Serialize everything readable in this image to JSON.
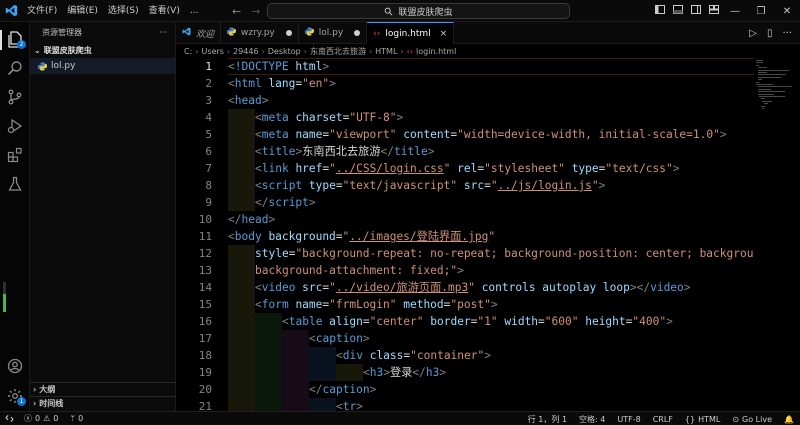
{
  "title_bar": {
    "menus": [
      "文件(F)",
      "编辑(E)",
      "选择(S)",
      "查看(V)",
      "..."
    ],
    "back_icon": "arrow-left-icon",
    "forward_icon": "arrow-right-icon",
    "search_text": "联盟皮肤爬虫"
  },
  "activity_bar": {
    "explorer_badge": "2",
    "accounts_badge": "",
    "manage_badge": "1",
    "icons": [
      "files-icon",
      "search-icon",
      "source-control-icon",
      "run-debug-icon",
      "extensions-icon",
      "testing-icon",
      "account-icon",
      "manage-gear-icon"
    ],
    "indicator_level": 0.6
  },
  "sidebar": {
    "header": "资源管理器",
    "more": "···",
    "folder": "联盟皮肤爬虫",
    "files": [
      {
        "name": "lol.py"
      }
    ],
    "sections": [
      "大纲",
      "时间线"
    ]
  },
  "tabs": [
    {
      "label": "欢迎",
      "icon": "vscode-icon",
      "italic": true
    },
    {
      "label": "wzry.py",
      "icon": "python-icon",
      "dirty": true
    },
    {
      "label": "lol.py",
      "icon": "python-icon",
      "dirty": true
    },
    {
      "label": "login.html",
      "icon": "html-icon",
      "active": true,
      "close": "×"
    }
  ],
  "tab_actions": {
    "run": "▷",
    "split": "▯",
    "more": "···"
  },
  "breadcrumb": [
    "C:",
    "Users",
    "29446",
    "Desktop",
    "东南西北去旅游",
    "HTML",
    "login.html"
  ],
  "editor": {
    "current_line": 1,
    "lines": [
      {
        "n": "1",
        "indent": 0,
        "tokens": [
          [
            "punc",
            "<"
          ],
          [
            "tag",
            "!DOCTYPE "
          ],
          [
            "attr",
            "html"
          ],
          [
            "punc",
            ">"
          ]
        ]
      },
      {
        "n": "2",
        "indent": 0,
        "tokens": [
          [
            "punc",
            "<"
          ],
          [
            "tag",
            "html "
          ],
          [
            "attr",
            "lang"
          ],
          [
            "txt",
            "="
          ],
          [
            "str",
            "\"en\""
          ],
          [
            "punc",
            ">"
          ]
        ]
      },
      {
        "n": "3",
        "indent": 0,
        "tokens": [
          [
            "punc",
            "<"
          ],
          [
            "tag",
            "head"
          ],
          [
            "punc",
            ">"
          ]
        ]
      },
      {
        "n": "4",
        "indent": 1,
        "tokens": [
          [
            "punc",
            "<"
          ],
          [
            "tag",
            "meta "
          ],
          [
            "attr",
            "charset"
          ],
          [
            "txt",
            "="
          ],
          [
            "str",
            "\"UTF-8\""
          ],
          [
            "punc",
            ">"
          ]
        ]
      },
      {
        "n": "5",
        "indent": 1,
        "tokens": [
          [
            "punc",
            "<"
          ],
          [
            "tag",
            "meta "
          ],
          [
            "attr",
            "name"
          ],
          [
            "txt",
            "="
          ],
          [
            "str",
            "\"viewport\" "
          ],
          [
            "attr",
            "content"
          ],
          [
            "txt",
            "="
          ],
          [
            "str",
            "\"width=device-width, initial-scale=1.0\""
          ],
          [
            "punc",
            ">"
          ]
        ]
      },
      {
        "n": "6",
        "indent": 1,
        "tokens": [
          [
            "punc",
            "<"
          ],
          [
            "tag",
            "title"
          ],
          [
            "punc",
            ">"
          ],
          [
            "txt",
            "东南西北去旅游"
          ],
          [
            "punc",
            "</"
          ],
          [
            "tag",
            "title"
          ],
          [
            "punc",
            ">"
          ]
        ]
      },
      {
        "n": "7",
        "indent": 1,
        "tokens": [
          [
            "punc",
            "<"
          ],
          [
            "tag",
            "link "
          ],
          [
            "attr",
            "href"
          ],
          [
            "txt",
            "="
          ],
          [
            "str",
            "\""
          ],
          [
            "strlink",
            "../CSS/login.css"
          ],
          [
            "str",
            "\" "
          ],
          [
            "attr",
            "rel"
          ],
          [
            "txt",
            "="
          ],
          [
            "str",
            "\"stylesheet\" "
          ],
          [
            "attr",
            "type"
          ],
          [
            "txt",
            "="
          ],
          [
            "str",
            "\"text/css\""
          ],
          [
            "punc",
            ">"
          ]
        ]
      },
      {
        "n": "8",
        "indent": 1,
        "tokens": [
          [
            "punc",
            "<"
          ],
          [
            "tag",
            "script "
          ],
          [
            "attr",
            "type"
          ],
          [
            "txt",
            "="
          ],
          [
            "str",
            "\"text/javascript\" "
          ],
          [
            "attr",
            "src"
          ],
          [
            "txt",
            "="
          ],
          [
            "str",
            "\""
          ],
          [
            "strlink",
            "../js/login.js"
          ],
          [
            "str",
            "\""
          ],
          [
            "punc",
            ">"
          ]
        ]
      },
      {
        "n": "9",
        "indent": 1,
        "tokens": [
          [
            "punc",
            "</"
          ],
          [
            "tag",
            "script"
          ],
          [
            "punc",
            ">"
          ]
        ]
      },
      {
        "n": "10",
        "indent": 0,
        "tokens": [
          [
            "punc",
            "</"
          ],
          [
            "tag",
            "head"
          ],
          [
            "punc",
            ">"
          ]
        ]
      },
      {
        "n": "11",
        "indent": 0,
        "tokens": [
          [
            "punc",
            "<"
          ],
          [
            "tag",
            "body "
          ],
          [
            "attr",
            "background"
          ],
          [
            "txt",
            "="
          ],
          [
            "str",
            "\""
          ],
          [
            "strlink",
            "../images/登陆界面.jpg"
          ],
          [
            "str",
            "\""
          ]
        ]
      },
      {
        "n": "12",
        "indent": 1,
        "tokens": [
          [
            "attr",
            "style"
          ],
          [
            "txt",
            "="
          ],
          [
            "str",
            "\"background-repeat: no-repeat; background-position: center; background-size: cover;"
          ]
        ]
      },
      {
        "n": "13",
        "indent": 1,
        "tokens": [
          [
            "str",
            "background-attachment: fixed;\""
          ],
          [
            "punc",
            ">"
          ]
        ]
      },
      {
        "n": "14",
        "indent": 1,
        "tokens": [
          [
            "punc",
            "<"
          ],
          [
            "tag",
            "video "
          ],
          [
            "attr",
            "src"
          ],
          [
            "txt",
            "="
          ],
          [
            "str",
            "\""
          ],
          [
            "strlink",
            "../video/旅游页面.mp3"
          ],
          [
            "str",
            "\" "
          ],
          [
            "attr",
            "controls autoplay loop"
          ],
          [
            "punc",
            "></"
          ],
          [
            "tag",
            "video"
          ],
          [
            "punc",
            ">"
          ]
        ]
      },
      {
        "n": "15",
        "indent": 1,
        "tokens": [
          [
            "punc",
            "<"
          ],
          [
            "tag",
            "form "
          ],
          [
            "attr",
            "name"
          ],
          [
            "txt",
            "="
          ],
          [
            "str",
            "\"frmLogin\" "
          ],
          [
            "attr",
            "method"
          ],
          [
            "txt",
            "="
          ],
          [
            "str",
            "\"post\""
          ],
          [
            "punc",
            ">"
          ]
        ]
      },
      {
        "n": "16",
        "indent": 2,
        "tokens": [
          [
            "punc",
            "<"
          ],
          [
            "tag",
            "table "
          ],
          [
            "attr",
            "align"
          ],
          [
            "txt",
            "="
          ],
          [
            "str",
            "\"center\" "
          ],
          [
            "attr",
            "border"
          ],
          [
            "txt",
            "="
          ],
          [
            "str",
            "\"1\" "
          ],
          [
            "attr",
            "width"
          ],
          [
            "txt",
            "="
          ],
          [
            "str",
            "\"600\" "
          ],
          [
            "attr",
            "height"
          ],
          [
            "txt",
            "="
          ],
          [
            "str",
            "\"400\""
          ],
          [
            "punc",
            ">"
          ]
        ]
      },
      {
        "n": "17",
        "indent": 3,
        "tokens": [
          [
            "punc",
            "<"
          ],
          [
            "tag",
            "caption"
          ],
          [
            "punc",
            ">"
          ]
        ]
      },
      {
        "n": "18",
        "indent": 4,
        "tokens": [
          [
            "punc",
            "<"
          ],
          [
            "tag",
            "div "
          ],
          [
            "attr",
            "class"
          ],
          [
            "txt",
            "="
          ],
          [
            "str",
            "\"container\""
          ],
          [
            "punc",
            ">"
          ]
        ]
      },
      {
        "n": "19",
        "indent": 5,
        "tokens": [
          [
            "punc",
            "<"
          ],
          [
            "tag",
            "h3"
          ],
          [
            "punc",
            ">"
          ],
          [
            "txt",
            "登录"
          ],
          [
            "punc",
            "</"
          ],
          [
            "tag",
            "h3"
          ],
          [
            "punc",
            ">"
          ]
        ]
      },
      {
        "n": "20",
        "indent": 3,
        "tokens": [
          [
            "punc",
            "</"
          ],
          [
            "tag",
            "caption"
          ],
          [
            "punc",
            ">"
          ]
        ]
      },
      {
        "n": "21",
        "indent": 4,
        "tokens": [
          [
            "punc",
            "<"
          ],
          [
            "tag",
            "tr"
          ],
          [
            "punc",
            ">"
          ]
        ]
      }
    ]
  },
  "status_bar": {
    "errors": "0",
    "warnings": "0",
    "info": "0",
    "position": "行 1，列 1",
    "spaces": "空格: 4",
    "encoding": "UTF-8",
    "eol": "CRLF",
    "language": "HTML",
    "golive": "Go Live"
  }
}
